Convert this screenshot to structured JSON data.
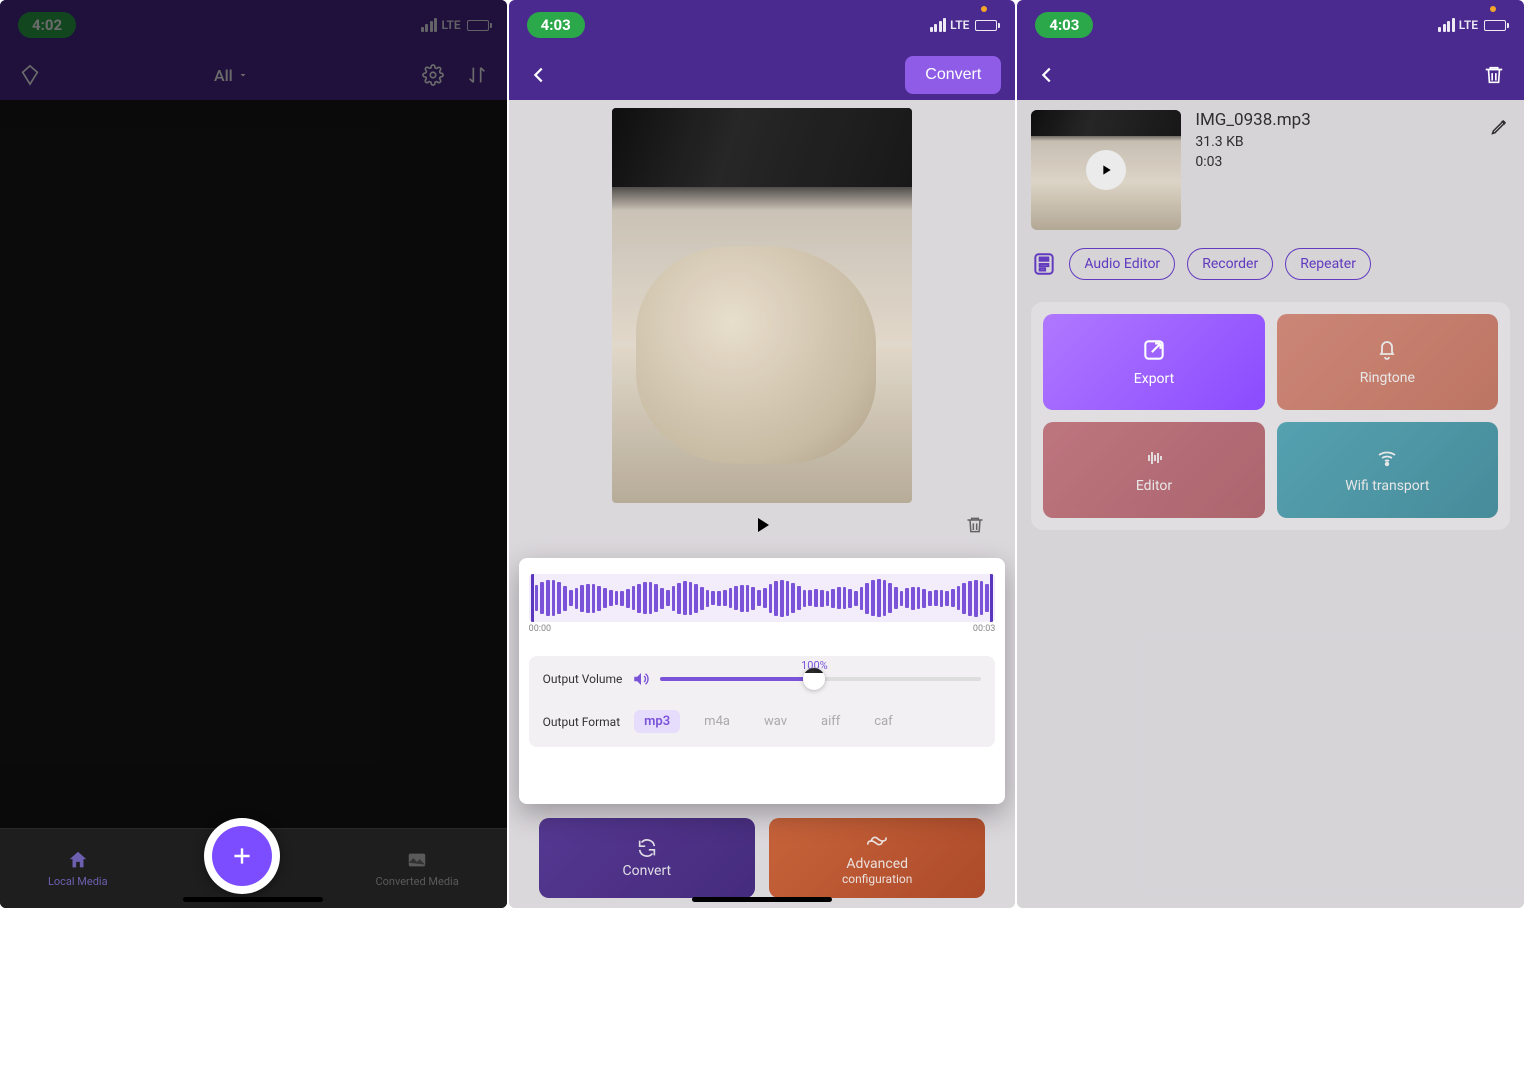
{
  "screen1": {
    "time": "4:02",
    "net": "LTE",
    "filter": "All",
    "nav": {
      "local": "Local Media",
      "converted": "Converted Media"
    }
  },
  "screen2": {
    "time": "4:03",
    "net": "LTE",
    "convert_btn": "Convert",
    "wf_start": "00:00",
    "wf_end": "00:03",
    "vol_label": "Output Volume",
    "vol_pct": "100%",
    "fmt_label": "Output Format",
    "fmts": {
      "mp3": "mp3",
      "m4a": "m4a",
      "wav": "wav",
      "aiff": "aiff",
      "caf": "caf"
    },
    "action_convert": "Convert",
    "action_advanced_l1": "Advanced",
    "action_advanced_l2": "configuration"
  },
  "screen3": {
    "time": "4:03",
    "net": "LTE",
    "file": {
      "name": "IMG_0938.mp3",
      "size": "31.3 KB",
      "duration": "0:03"
    },
    "pills": {
      "audio": "Audio Editor",
      "recorder": "Recorder",
      "repeater": "Repeater"
    },
    "tiles": {
      "export": "Export",
      "ringtone": "Ringtone",
      "editor": "Editor",
      "wifi": "Wifi transport"
    }
  }
}
